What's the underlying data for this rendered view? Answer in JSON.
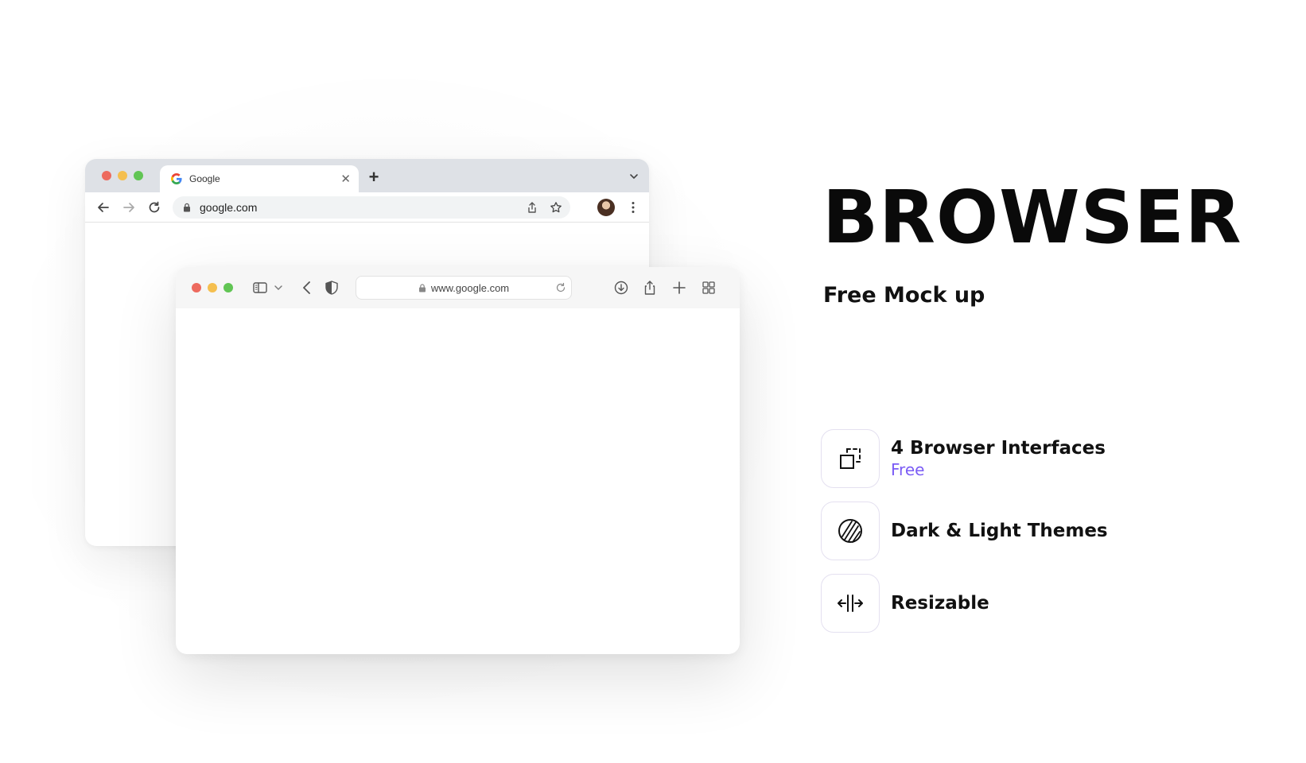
{
  "chrome": {
    "tab_title": "Google",
    "tab_close": "✕",
    "new_tab": "+",
    "url": "google.com"
  },
  "safari": {
    "url": "www.google.com"
  },
  "hero": {
    "title": "BROWSER",
    "subtitle": "Free Mock up"
  },
  "features": [
    {
      "label": "4 Browser Interfaces",
      "sub": "Free",
      "icon": "select-resize-icon"
    },
    {
      "label": "Dark & Light Themes",
      "icon": "theme-contrast-icon"
    },
    {
      "label": "Resizable",
      "icon": "resize-horizontal-icon"
    }
  ],
  "colors": {
    "accent": "#7b5cf5",
    "traffic_red": "#ed6a5e",
    "traffic_yellow": "#f5bf4f",
    "traffic_green": "#61c554"
  }
}
